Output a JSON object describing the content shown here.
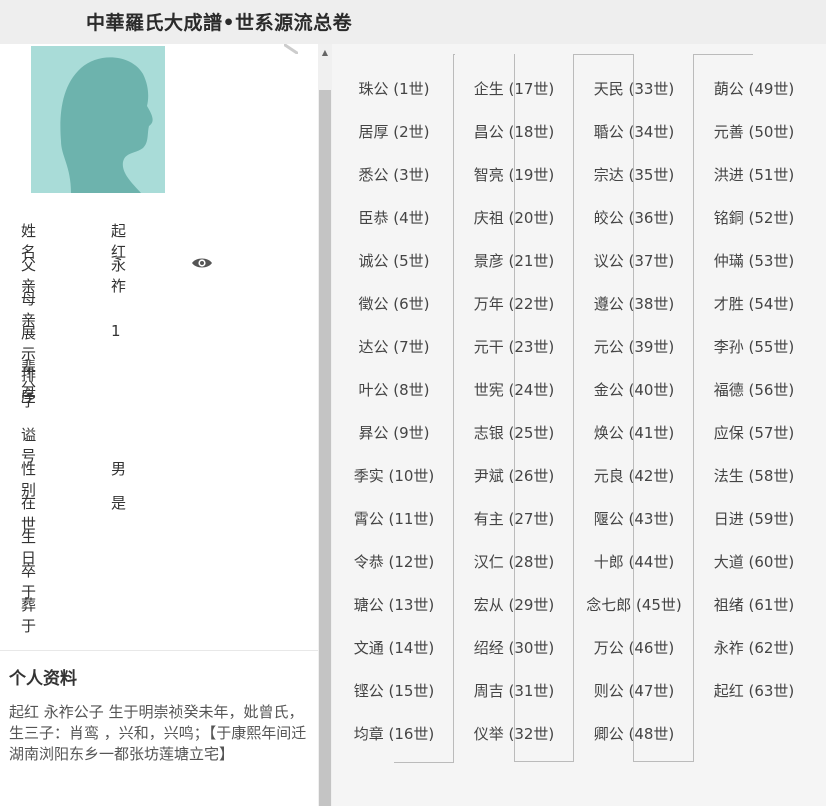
{
  "header": {
    "title": "中華羅氏大成譜•世系源流总卷"
  },
  "person": {
    "fields": [
      {
        "label": "姓名",
        "value": "起红"
      },
      {
        "label": "父亲",
        "value": "永祚"
      },
      {
        "label": "母亲",
        "value": ""
      },
      {
        "label": "展示排序",
        "value": "1"
      },
      {
        "label": "辈分",
        "value": ""
      },
      {
        "label": "字",
        "value": ""
      },
      {
        "label": "谥号",
        "value": ""
      },
      {
        "label": "性别",
        "value": "男"
      },
      {
        "label": "在世",
        "value": "是"
      },
      {
        "label": "生日",
        "value": ""
      },
      {
        "label": "卒于",
        "value": ""
      },
      {
        "label": "葬于",
        "value": ""
      }
    ],
    "icons": {
      "view_father": "eye-icon",
      "avatar": "person-silhouette-icon"
    }
  },
  "bio": {
    "heading": "个人资料",
    "text": "起红 永祚公子 生于明崇祯癸未年，妣曾氏，生三子：肖鸾 ，兴和，兴鸣；【于康熙年间迁湖南浏阳东乡一都张坊莲塘立宅】"
  },
  "generations": [
    [
      "珠公 (1世)",
      "居厚 (2世)",
      "悉公 (3世)",
      "臣恭 (4世)",
      "诚公 (5世)",
      "徵公 (6世)",
      "达公 (7世)",
      "叶公 (8世)",
      "昪公 (9世)",
      "季实 (10世)",
      "霄公 (11世)",
      "令恭 (12世)",
      "瑭公 (13世)",
      "文通 (14世)",
      "铿公 (15世)",
      "均章 (16世)"
    ],
    [
      "企生 (17世)",
      "昌公 (18世)",
      "智亮 (19世)",
      "庆祖 (20世)",
      "景彦 (21世)",
      "万年 (22世)",
      "元干 (23世)",
      "世宪 (24世)",
      "志银 (25世)",
      "尹斌 (26世)",
      "有主 (27世)",
      "汉仁 (28世)",
      "宏从 (29世)",
      "绍经 (30世)",
      "周吉 (31世)",
      "仪举 (32世)"
    ],
    [
      "天民 (33世)",
      "䎽公 (34世)",
      "宗达 (35世)",
      "皎公 (36世)",
      "议公 (37世)",
      "遵公 (38世)",
      "元公 (39世)",
      "金公 (40世)",
      "焕公 (41世)",
      "元良 (42世)",
      "隁公 (43世)",
      "十郎 (44世)",
      "念七郎 (45世)",
      "万公 (46世)",
      "则公 (47世)",
      "卿公 (48世)"
    ],
    [
      "蓢公 (49世)",
      "元善 (50世)",
      "洪进 (51世)",
      "铭銅 (52世)",
      "仲璊 (53世)",
      "才胜 (54世)",
      "李孙 (55世)",
      "福德 (56世)",
      "应保 (57世)",
      "法生 (58世)",
      "日进 (59世)",
      "大道 (60世)",
      "祖绪 (61世)",
      "永祚 (62世)",
      "起红 (63世)"
    ]
  ],
  "colors": {
    "avatar_bg": "#a9dcd8",
    "avatar_fg": "#6db3ad",
    "panel_bg": "#f5f5f5",
    "header_bg": "#eeeeee"
  }
}
